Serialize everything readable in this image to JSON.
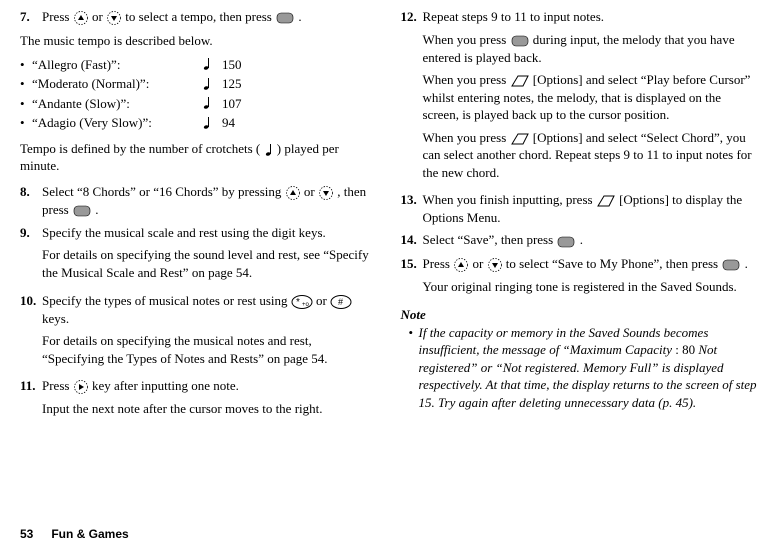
{
  "col1": {
    "step7": {
      "num": "7.",
      "text_a": "Press ",
      "text_b": " or ",
      "text_c": " to select a tempo, then press ",
      "text_d": "."
    },
    "tempo_intro": "The music tempo is described below.",
    "tempo_rows": [
      {
        "bullet": "•",
        "label": "“Allegro (Fast)”:",
        "val": "150"
      },
      {
        "bullet": "•",
        "label": "“Moderato (Normal)”:",
        "val": "125"
      },
      {
        "bullet": "•",
        "label": "“Andante (Slow)”:",
        "val": "107"
      },
      {
        "bullet": "•",
        "label": "“Adagio (Very Slow)”:",
        "val": "94"
      }
    ],
    "tempo_note_a": "Tempo is defined by the number of crotchets ( ",
    "tempo_note_b": " ) played per minute.",
    "step8": {
      "num": "8.",
      "text_a": "Select “8 Chords” or “16 Chords” by pressing ",
      "text_b": " or ",
      "text_c": ", then press ",
      "text_d": "."
    },
    "step9": {
      "num": "9.",
      "p1": "Specify the musical scale and rest using the digit keys.",
      "p2": "For details on specifying the sound level and rest, see “Specify the Musical Scale and Rest” on page 54."
    },
    "step10": {
      "num": "10.",
      "p1_a": "Specify the types of musical notes or rest using ",
      "p1_b": " or ",
      "p1_c": " keys.",
      "p2": "For details on specifying the musical notes and rest, “Specifying the Types of Notes and Rests” on page 54."
    },
    "step11": {
      "num": "11.",
      "p1_a": "Press ",
      "p1_b": " key after inputting one note.",
      "p2": "Input the next note after the cursor moves to the right."
    }
  },
  "col2": {
    "step12": {
      "num": "12.",
      "p1": "Repeat steps 9 to 11 to input notes.",
      "p2_a": "When you press ",
      "p2_b": " during input, the melody that you have entered is played back.",
      "p3_a": "When you press ",
      "p3_b": " [Options] and select “Play before Cursor” whilst entering notes, the melody, that is displayed on the screen, is played back up to the cursor position.",
      "p4_a": "When you press ",
      "p4_b": " [Options] and select “Select Chord”, you can select another chord. Repeat steps 9 to 11 to input notes for the new chord."
    },
    "step13": {
      "num": "13.",
      "p1_a": "When you finish inputting, press ",
      "p1_b": " [Options] to display the Options Menu."
    },
    "step14": {
      "num": "14.",
      "p1_a": "Select “Save”, then press ",
      "p1_b": "."
    },
    "step15": {
      "num": "15.",
      "p1_a": "Press ",
      "p1_b": " or ",
      "p1_c": " to select “Save to My Phone”, then press ",
      "p1_d": ".",
      "p2": "Your original ringing tone is registered in the Saved Sounds."
    },
    "note_head": "Note",
    "note_bullet": "•",
    "note_text_a": "If the capacity or memory in the Saved Sounds becomes insufficient, the message of “Maximum Capacity ",
    "note_text_b": ": 80 ",
    "note_text_c": "Not registered” or “Not registered. Memory Full” is displayed respectively. At that time, the display returns to the screen of step 15. Try again after deleting unnecessary data (p. 45)."
  },
  "footer": {
    "page": "53",
    "section": "Fun & Games"
  }
}
